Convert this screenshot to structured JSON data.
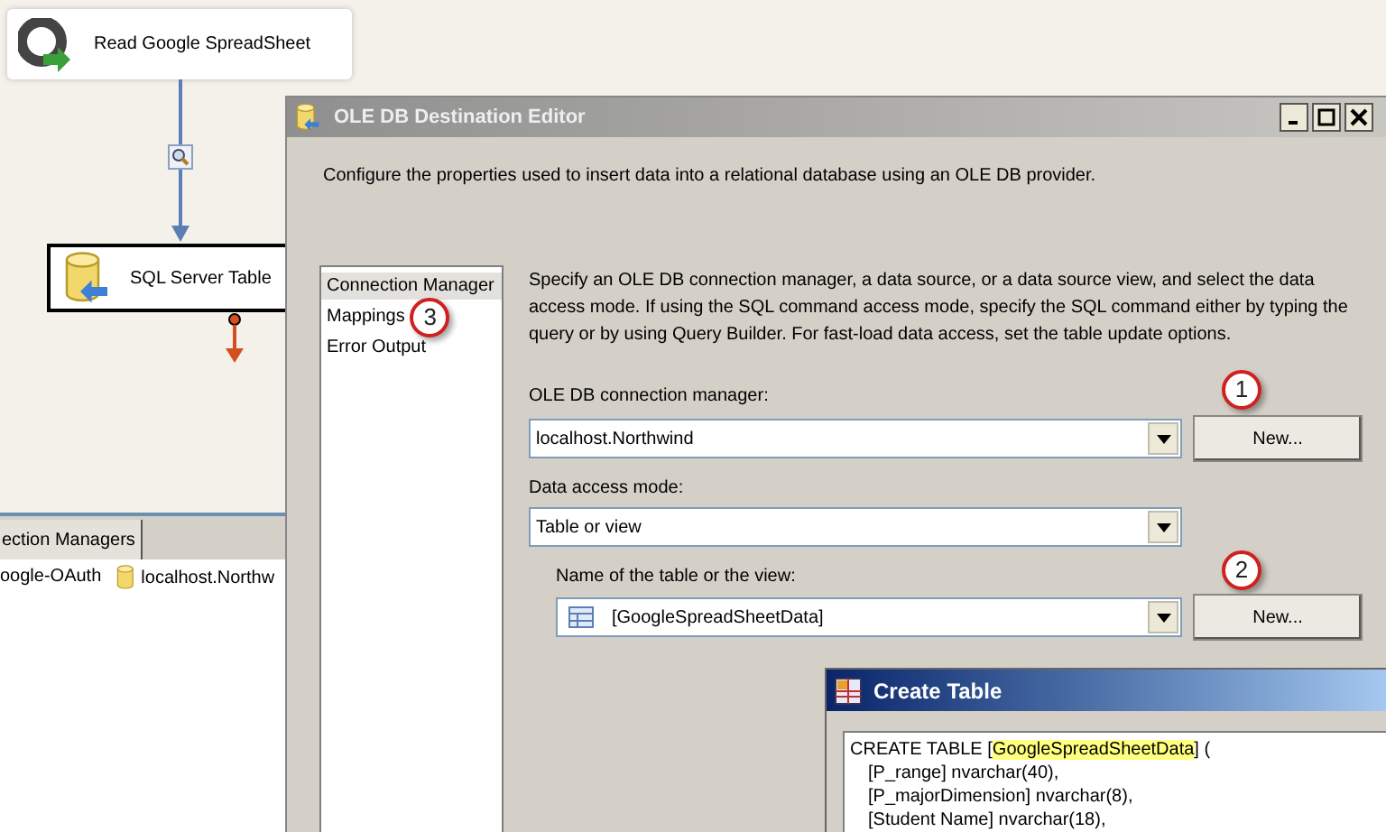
{
  "designer": {
    "nodes": [
      {
        "label": "Read Google SpreadSheet",
        "kind": "source"
      },
      {
        "label": "SQL Server Table",
        "kind": "destination"
      }
    ],
    "connections_tab": {
      "label": "ection Managers"
    },
    "connections": [
      {
        "label": "oogle-OAuth",
        "kind": "oauth"
      },
      {
        "label": "localhost.Northw",
        "kind": "database"
      }
    ]
  },
  "editor": {
    "title": "OLE DB Destination Editor",
    "description": "Configure the properties used to insert data into a relational database using an OLE DB provider.",
    "nav": [
      {
        "label": "Connection Manager",
        "selected": true
      },
      {
        "label": "Mappings",
        "selected": false,
        "callout": "3"
      },
      {
        "label": "Error Output",
        "selected": false
      }
    ],
    "intro": "Specify an OLE DB connection manager, a data source, or a data source view, and select the data access mode. If using the SQL command access mode, specify the SQL command either by typing the query or by using Query Builder. For fast-load data access, set the table update options.",
    "connection_label": "OLE DB connection manager:",
    "connection_value": "localhost.Northwind",
    "connection_button": "New...",
    "connection_callout": "1",
    "mode_label": "Data access mode:",
    "mode_value": "Table or view",
    "table_label": "Name of the table or the view:",
    "table_value": "[GoogleSpreadSheetData]",
    "table_button": "New...",
    "table_callout": "2"
  },
  "create_table": {
    "title": "Create Table",
    "first_line": {
      "prefix": "CREATE TABLE [",
      "highlight": "GoogleSpreadSheetData",
      "suffix": "] ("
    },
    "lines": [
      "[P_range] nvarchar(40),",
      "[P_majorDimension] nvarchar(8),",
      "[Student Name] nvarchar(18),"
    ]
  }
}
